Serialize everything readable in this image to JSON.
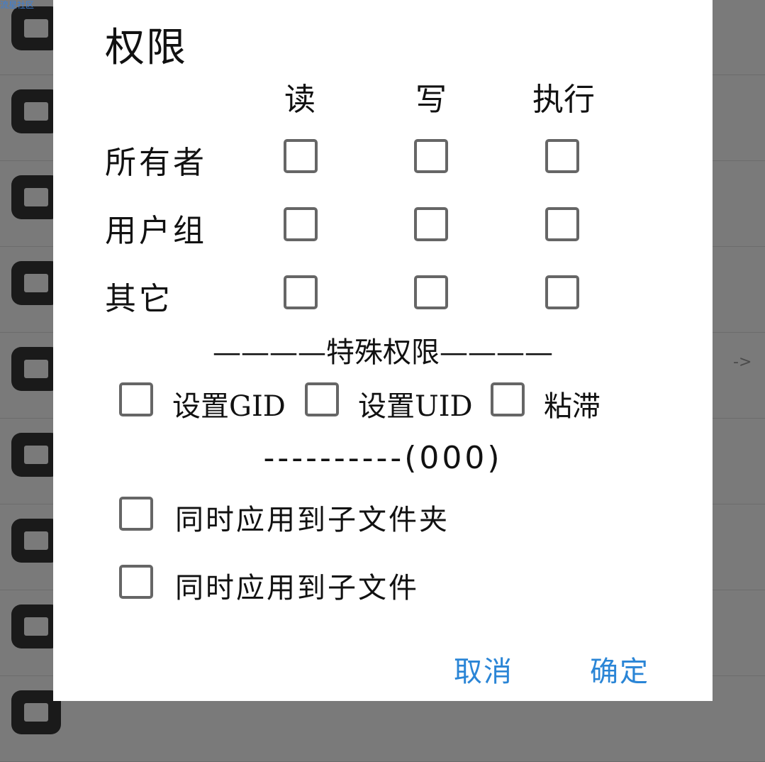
{
  "watermark": "流星社区",
  "background": {
    "arrow": "->"
  },
  "dialog": {
    "title": "权限",
    "columns": [
      "读",
      "写",
      "执行"
    ],
    "rows": [
      {
        "label": "所有者",
        "checked": [
          false,
          false,
          false
        ]
      },
      {
        "label": "用户组",
        "checked": [
          false,
          false,
          false
        ]
      },
      {
        "label": "其它",
        "checked": [
          false,
          false,
          false
        ]
      }
    ],
    "special_divider": "————特殊权限————",
    "special": [
      {
        "label": "设置GID",
        "checked": false
      },
      {
        "label": "设置UID",
        "checked": false
      },
      {
        "label": "粘滞",
        "checked": false
      }
    ],
    "octal_line": "----------(000)",
    "apply_options": [
      {
        "label": "同时应用到子文件夹",
        "checked": false
      },
      {
        "label": "同时应用到子文件",
        "checked": false
      }
    ],
    "cancel_label": "取消",
    "ok_label": "确定"
  },
  "colors": {
    "accent": "#2a85d6",
    "checkbox_border": "#666666",
    "overlay": "#7a7a7a"
  }
}
